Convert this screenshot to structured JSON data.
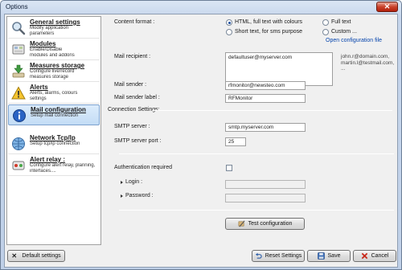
{
  "window": {
    "title": "Options",
    "close_glyph": "✕"
  },
  "sidebar": {
    "items": [
      {
        "title": "General settings",
        "desc1": "Modify application",
        "desc2": "parameters",
        "icon": "magnifier-icon"
      },
      {
        "title": "Modules",
        "desc1": "Enable/Disable",
        "desc2": "modules and addons",
        "icon": "modules-icon"
      },
      {
        "title": "Measures storage",
        "desc1": "Configure live/record",
        "desc2": "measures storage",
        "icon": "download-icon"
      },
      {
        "title": "Alerts",
        "desc1": "Alerts, alarms, colours",
        "desc2": "settings",
        "icon": "warning-icon"
      },
      {
        "title": "Mail configuration",
        "desc1": "Setup mail connection",
        "desc2": "",
        "icon": "info-icon"
      },
      {
        "title": "Network Tcp/Ip",
        "desc1": "Setup tcp/ip connection",
        "desc2": "",
        "icon": "network-icon"
      },
      {
        "title": "Alert relay :",
        "desc1": "Configure alert relay, planning,",
        "desc2": "interfaces....",
        "icon": "relay-icon"
      }
    ],
    "selected_index": 4
  },
  "mail": {
    "content_format_label": "Content format :",
    "format_options": [
      {
        "label": "HTML, full text with colours",
        "selected": true
      },
      {
        "label": "Full text",
        "selected": false
      },
      {
        "label": "Short text, for sms purpose",
        "selected": false
      },
      {
        "label": "Custom ...",
        "selected": false
      }
    ],
    "open_config_link": "Open configuration file",
    "recipient_label": "Mail recipient :",
    "recipient_value": "defaultuser@myserver.com",
    "recipient_hint": [
      "john.r@domain.com,",
      "martin.l@testmail.com,",
      "..."
    ],
    "sender_label": "Mail sender :",
    "sender_value": "rfmonitor@newsteo.com",
    "sender_label_label": "Mail sender label :",
    "sender_label_value": "RFMonitor"
  },
  "connection": {
    "section_label": "Connection Settings:",
    "smtp_server_label": "SMTP server :",
    "smtp_server_value": "smtp.myserver.com",
    "smtp_port_label": "SMTP server port :",
    "smtp_port_value": "25",
    "auth_label": "Authentication required",
    "auth_checked": false,
    "login_label": "Login :",
    "password_label": "Password :"
  },
  "buttons": {
    "test_configuration": "Test configuration",
    "default_settings": "Default settings",
    "reset_settings": "Reset Settings",
    "save": "Save",
    "cancel": "Cancel"
  }
}
